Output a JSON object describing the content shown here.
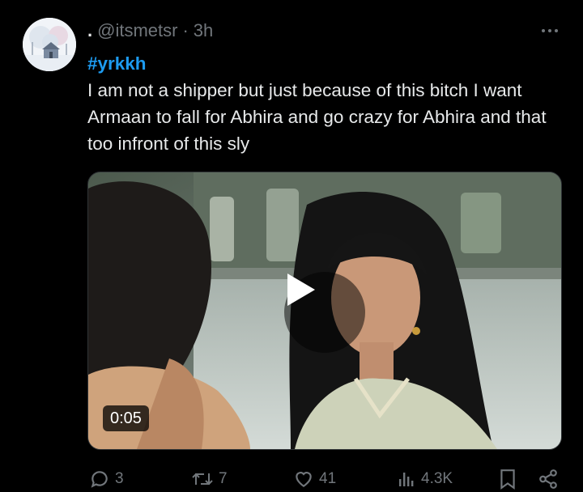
{
  "tweet": {
    "handle_prefix": ".",
    "handle": "@itsmetsr",
    "separator": "·",
    "time": "3h",
    "hashtag": "#yrkkh",
    "body": "I am not a shipper but just because of this bitch I want Armaan to fall for Abhira and go crazy for Abhira and that too infront of this sly"
  },
  "media": {
    "duration": "0:05",
    "play_icon": "play-icon"
  },
  "actions": {
    "replies": "3",
    "retweets": "7",
    "likes": "41",
    "views": "4.3K",
    "icons": [
      "reply-icon",
      "retweet-icon",
      "like-icon",
      "views-icon",
      "bookmark-icon",
      "share-icon"
    ]
  },
  "colors": {
    "background": "#000000",
    "text": "#e7e9ea",
    "muted": "#71767b",
    "accent": "#1d9bf0"
  }
}
